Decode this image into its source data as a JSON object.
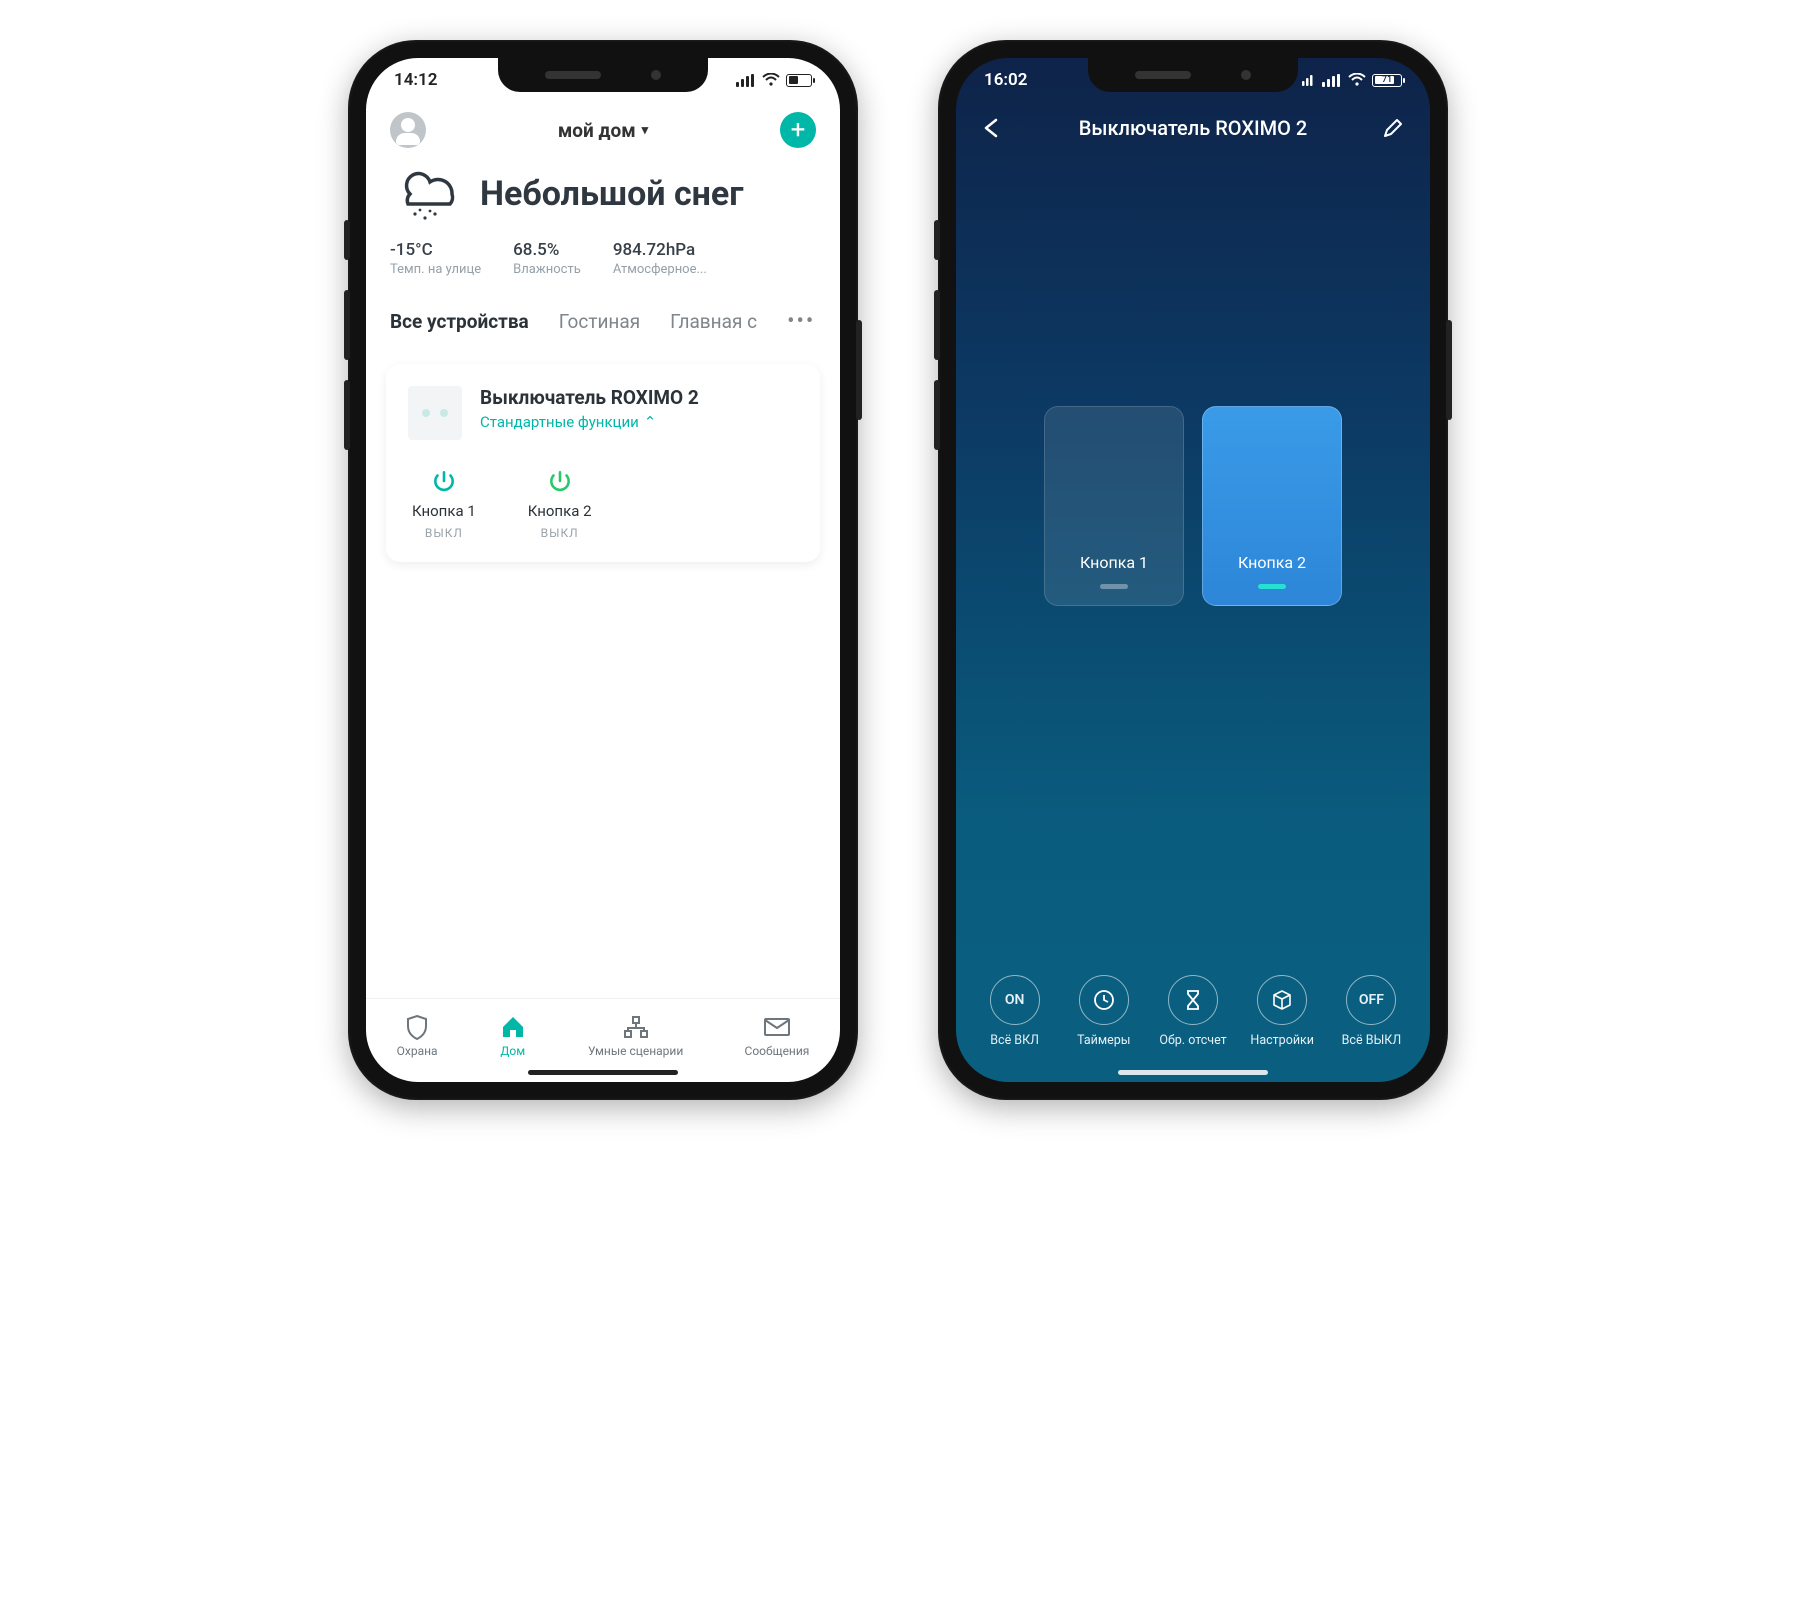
{
  "left": {
    "statusbar": {
      "time": "14:12"
    },
    "header": {
      "home_label": "мой дом",
      "add_label": "+"
    },
    "weather": {
      "description": "Небольшой снег",
      "stats": [
        {
          "value": "-15°C",
          "label": "Темп. на улице"
        },
        {
          "value": "68.5%",
          "label": "Влажность"
        },
        {
          "value": "984.72hPa",
          "label": "Атмосферное..."
        }
      ]
    },
    "roomtabs": {
      "items": [
        "Все устройства",
        "Гостиная",
        "Главная с"
      ],
      "more": "•••"
    },
    "device": {
      "name": "Выключатель ROXIMO 2",
      "sub": "Стандартные функции",
      "buttons": [
        {
          "label": "Кнопка 1",
          "state": "ВЫКЛ",
          "color": "#00b7a8"
        },
        {
          "label": "Кнопка 2",
          "state": "ВЫКЛ",
          "color": "#27c96b"
        }
      ]
    },
    "bottombar": {
      "items": [
        "Охрана",
        "Дом",
        "Умные сценарии",
        "Сообщения"
      ]
    }
  },
  "right": {
    "statusbar": {
      "time": "16:02",
      "battery_pct": "71"
    },
    "title": "Выключатель ROXIMO 2",
    "switches": [
      {
        "label": "Кнопка 1",
        "on": false
      },
      {
        "label": "Кнопка 2",
        "on": true
      }
    ],
    "controls": [
      {
        "code": "ON",
        "label": "Всё ВКЛ"
      },
      {
        "code": "clock",
        "label": "Таймеры"
      },
      {
        "code": "hourglass",
        "label": "Обр. отсчет"
      },
      {
        "code": "cube",
        "label": "Настройки"
      },
      {
        "code": "OFF",
        "label": "Всё ВЫКЛ"
      }
    ]
  }
}
